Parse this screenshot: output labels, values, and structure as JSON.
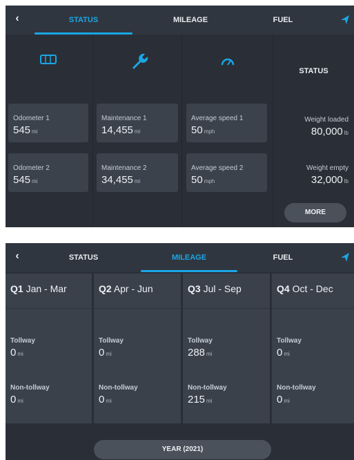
{
  "colors": {
    "accent": "#1aa7e6",
    "panel_bg": "#2a2f37",
    "card_bg": "#3b424c",
    "text": "#eef2f6"
  },
  "status_screen": {
    "tabs": [
      {
        "label": "STATUS",
        "active": true
      },
      {
        "label": "MILEAGE",
        "active": false
      },
      {
        "label": "FUEL",
        "active": false
      }
    ],
    "icons": [
      "odometer-icon",
      "wrench-icon",
      "speedometer-icon"
    ],
    "columns": [
      {
        "cards": [
          {
            "label": "Odometer 1",
            "value": "545",
            "unit": "mi"
          },
          {
            "label": "Odometer 2",
            "value": "545",
            "unit": "mi"
          }
        ]
      },
      {
        "cards": [
          {
            "label": "Maintenance 1",
            "value": "14,455",
            "unit": "mi"
          },
          {
            "label": "Maintenance 2",
            "value": "34,455",
            "unit": "mi"
          }
        ]
      },
      {
        "cards": [
          {
            "label": "Average speed 1",
            "value": "50",
            "unit": "mph"
          },
          {
            "label": "Average speed 2",
            "value": "50",
            "unit": "mph"
          }
        ]
      }
    ],
    "status": {
      "title": "STATUS",
      "items": [
        {
          "label": "Weight loaded",
          "value": "80,000",
          "unit": "lb"
        },
        {
          "label": "Weight empty",
          "value": "32,000",
          "unit": "lb"
        }
      ],
      "more_label": "MORE"
    }
  },
  "mileage_screen": {
    "tabs": [
      {
        "label": "STATUS",
        "active": false
      },
      {
        "label": "MILEAGE",
        "active": true
      },
      {
        "label": "FUEL",
        "active": false
      }
    ],
    "quarters": [
      {
        "q": "Q1",
        "range": "Jan - Mar",
        "tollway_label": "Tollway",
        "tollway": "0",
        "nontollway_label": "Non-tollway",
        "nontollway": "0",
        "unit": "mi"
      },
      {
        "q": "Q2",
        "range": "Apr - Jun",
        "tollway_label": "Tollway",
        "tollway": "0",
        "nontollway_label": "Non-tollway",
        "nontollway": "0",
        "unit": "mi"
      },
      {
        "q": "Q3",
        "range": "Jul - Sep",
        "tollway_label": "Tollway",
        "tollway": "288",
        "nontollway_label": "Non-tollway",
        "nontollway": "215",
        "unit": "mi"
      },
      {
        "q": "Q4",
        "range": "Oct - Dec",
        "tollway_label": "Tollway",
        "tollway": "0",
        "nontollway_label": "Non-tollway",
        "nontollway": "0",
        "unit": "mi"
      }
    ],
    "year_label": "YEAR (2021)"
  }
}
